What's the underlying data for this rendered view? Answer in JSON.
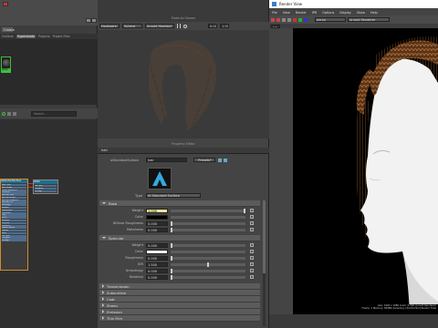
{
  "outliner": {
    "tabs": [
      "Outliner",
      "Hypershade",
      "Projects",
      "Project Files"
    ],
    "active_tab": "Hypershade",
    "create_label": "Create",
    "search_placeholder": "Search...",
    "swatch_label": "aiHair"
  },
  "nodes": {
    "main_header": "aiStandardSurface",
    "secondary_header": "aiHair",
    "main_attrs": [
      "Base Color",
      "Base Weight",
      "Diffuse Roughness",
      "Metalness",
      "Specular Color",
      "Specular Weight",
      "Specular Roughness",
      "Specular IOR",
      "Anisotropy",
      "Rotation",
      "Transmission",
      "Subsurface",
      "Coat",
      "Sheen",
      "Emission",
      "Thin Film",
      "Geometry",
      "Normal Camera",
      "Opacity",
      "Matte",
      "Out Color",
      "Out Alpha",
      "Message"
    ],
    "secondary_attrs": [
      "Out Color",
      "Out Alpha",
      "Message"
    ]
  },
  "viewport": {
    "title": "Material Viewer",
    "menus": [
      "Hardware",
      "Sphere",
      "Arnold Headset"
    ],
    "zoom_values": [
      "0.00",
      "1.00"
    ]
  },
  "property_editor": {
    "title": "Property Editor",
    "tab": "hair",
    "node_type_label": "aiStandardSurface",
    "node_name": "hair",
    "presets_label": "Presets*",
    "type_label": "Type",
    "type_value": "AI Standard Surface",
    "sections": {
      "base": "Base",
      "specular": "Specular",
      "collapsed": [
        "Transmission",
        "Subsurface",
        "Coat",
        "Sheen",
        "Emission",
        "Thin Film"
      ]
    },
    "base": [
      {
        "label": "Weight",
        "value": "1.000",
        "highlight": true
      },
      {
        "label": "Color",
        "value": ""
      },
      {
        "label": "Diffuse Roughness",
        "value": "0.000"
      },
      {
        "label": "Metalness",
        "value": "0.000"
      }
    ],
    "specular": [
      {
        "label": "Weight",
        "value": "0.000"
      },
      {
        "label": "Color",
        "value": ""
      },
      {
        "label": "Roughness",
        "value": "0.000"
      },
      {
        "label": "IOR",
        "value": "1.500"
      },
      {
        "label": "Anisotropy",
        "value": "0.000"
      },
      {
        "label": "Rotation",
        "value": "0.000"
      }
    ]
  },
  "render_view": {
    "title": "Render View",
    "menus": [
      "File",
      "View",
      "Render",
      "IPR",
      "Options",
      "Display",
      "Show",
      "Help"
    ],
    "camera_select": "persp",
    "renderer_select": "Arnold Renderer",
    "zoom": "0.5",
    "status_line": "size: 1920 x 1080 zoom: 0.500   (Arnold Renderer)",
    "status_line2": "Frame: 1   Memory: 839Mb   Sampling: [3/2/2/2/2/2]   Render Time"
  },
  "colors": {
    "accent_green": "#3fbf3f",
    "highlight_field": "#e8e49a",
    "hair": "#7a4a22",
    "skin": "#f2f2f2"
  }
}
